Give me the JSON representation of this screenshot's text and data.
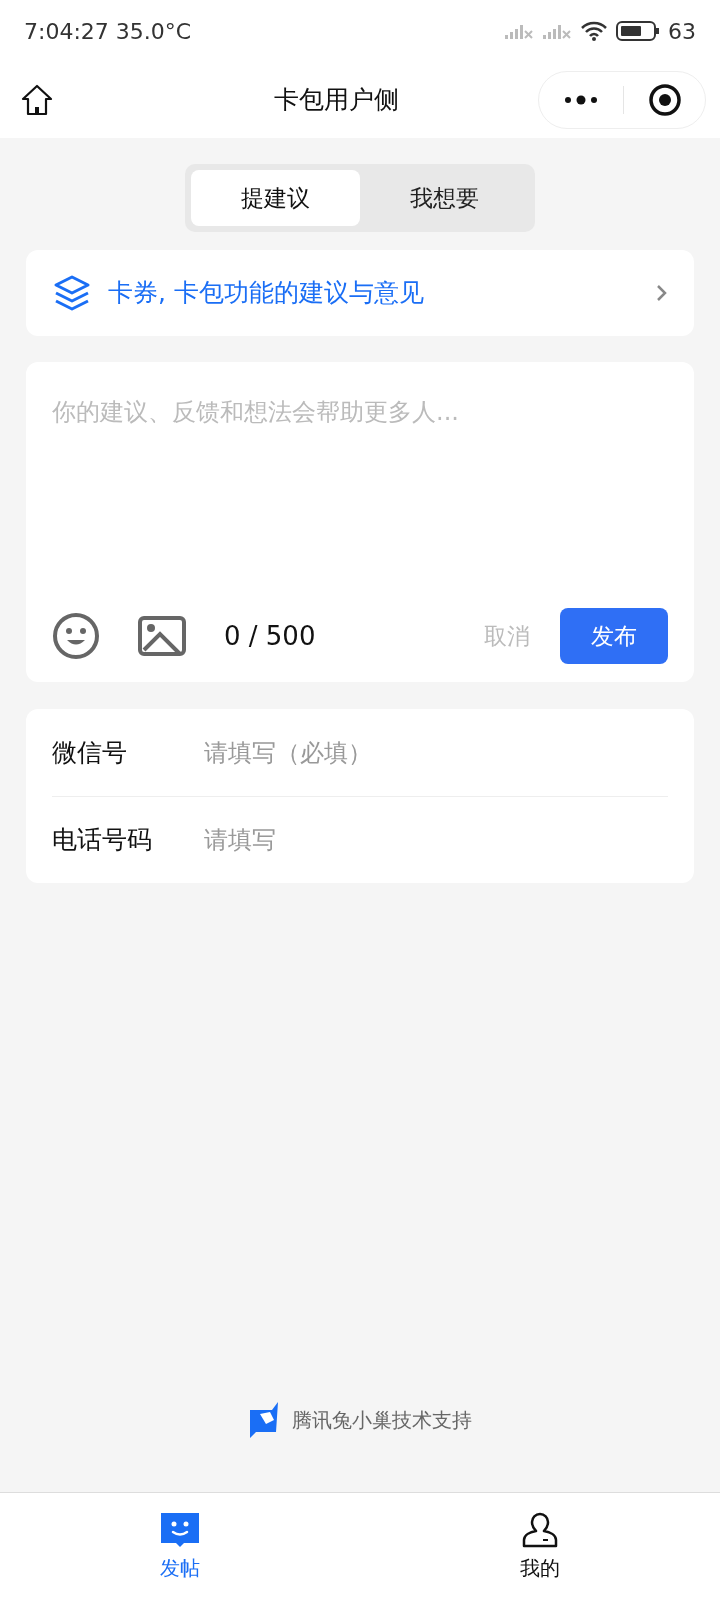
{
  "status_bar": {
    "time": "7:04:27 35.0°C",
    "battery": "63"
  },
  "header": {
    "title": "卡包用户侧"
  },
  "tabs": [
    {
      "label": "提建议",
      "selected": true
    },
    {
      "label": "我想要",
      "selected": false
    }
  ],
  "topic": {
    "label": "卡券, 卡包功能的建议与意见"
  },
  "composer": {
    "placeholder": "你的建议、反馈和想法会帮助更多人...",
    "counter": "0 / 500",
    "cancel": "取消",
    "submit": "发布"
  },
  "form": [
    {
      "label": "微信号",
      "placeholder": "请填写（必填）"
    },
    {
      "label": "电话号码",
      "placeholder": "请填写"
    }
  ],
  "footer": {
    "text": "腾讯兔小巢技术支持"
  },
  "nav": [
    {
      "label": "发帖",
      "kind": "post",
      "selected": true
    },
    {
      "label": "我的",
      "kind": "me",
      "selected": false
    }
  ]
}
